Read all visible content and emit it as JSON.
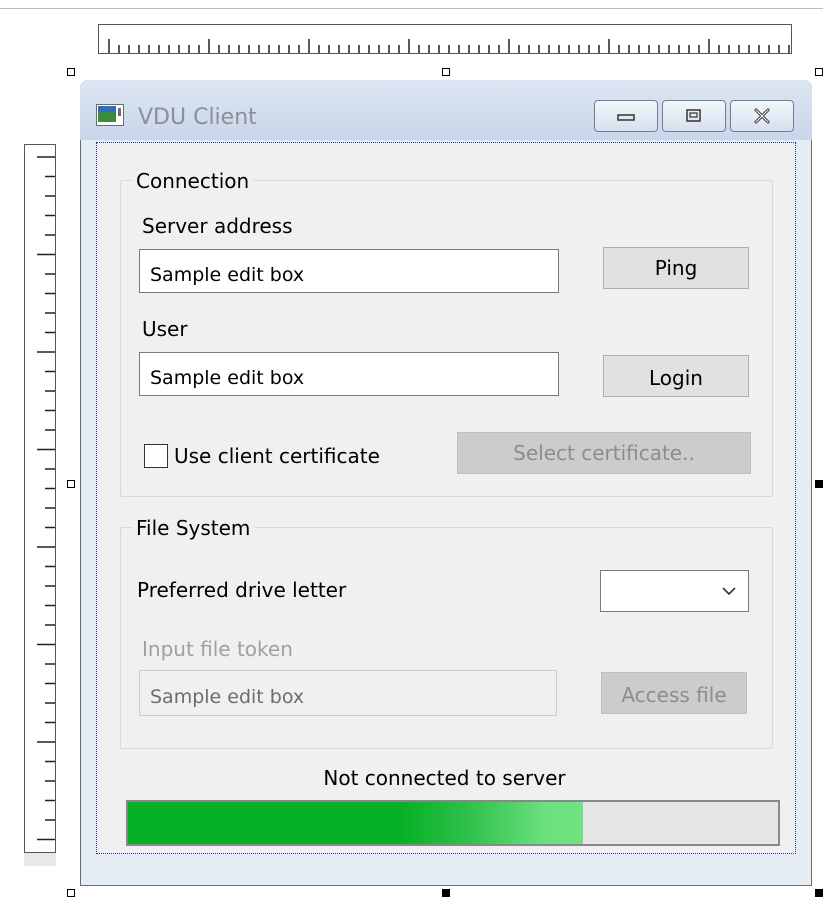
{
  "window": {
    "title": "VDU Client",
    "icon": "app-window-icon",
    "controls": [
      "minimize-icon",
      "restore-icon",
      "close-icon"
    ]
  },
  "connection": {
    "group_label": "Connection",
    "server_address_label": "Server address",
    "server_address_value": "Sample edit box",
    "ping_label": "Ping",
    "user_label": "User",
    "user_value": "Sample edit box",
    "login_label": "Login",
    "use_cert_label": "Use client certificate",
    "use_cert_checked": false,
    "select_cert_label": "Select certificate.."
  },
  "file_system": {
    "group_label": "File System",
    "drive_letter_label": "Preferred drive letter",
    "drive_letter_value": "",
    "input_token_label": "Input file token",
    "input_token_value": "Sample edit box",
    "access_file_label": "Access file"
  },
  "status": {
    "text": "Not connected to server",
    "progress_percent": 70
  },
  "colors": {
    "progress_green": "#06b025",
    "focus_dots": "#2929b8",
    "disabled_text": "#a0a0a0"
  }
}
